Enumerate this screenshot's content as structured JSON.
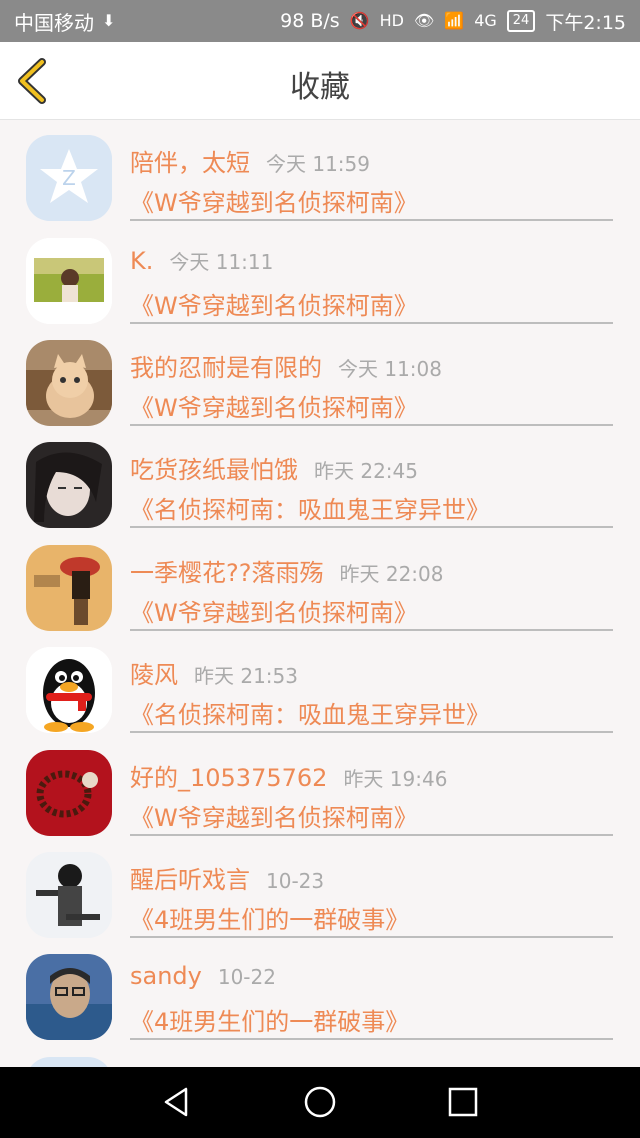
{
  "status_bar": {
    "carrier": "中国移动",
    "speed": "98 B/s",
    "network": "4G",
    "battery": "24",
    "time": "下午2:15"
  },
  "header": {
    "title": "收藏"
  },
  "items": [
    {
      "name": "陪伴，太短",
      "time": "今天 11:59",
      "book": "《W爷穿越到名侦探柯南》"
    },
    {
      "name": "K.",
      "time": "今天 11:11",
      "book": "《W爷穿越到名侦探柯南》"
    },
    {
      "name": "我的忍耐是有限的",
      "time": "今天 11:08",
      "book": "《W爷穿越到名侦探柯南》"
    },
    {
      "name": "吃货孩纸最怕饿",
      "time": "昨天 22:45",
      "book": "《名侦探柯南：吸血鬼王穿异世》"
    },
    {
      "name": "一季樱花??落雨殇",
      "time": "昨天 22:08",
      "book": "《W爷穿越到名侦探柯南》"
    },
    {
      "name": "陵风",
      "time": "昨天 21:53",
      "book": "《名侦探柯南：吸血鬼王穿异世》"
    },
    {
      "name": "好的_105375762",
      "time": "昨天 19:46",
      "book": "《W爷穿越到名侦探柯南》"
    },
    {
      "name": "醒后听戏言",
      "time": "10-23",
      "book": "《4班男生们的一群破事》"
    },
    {
      "name": "sandy",
      "time": "10-22",
      "book": "《4班男生们的一群破事》"
    },
    {
      "name": "",
      "time": "",
      "book": ""
    }
  ],
  "colors": {
    "accent": "#ee8a55",
    "status_bar": "#8a8a8a",
    "background": "#f8f5f5"
  }
}
